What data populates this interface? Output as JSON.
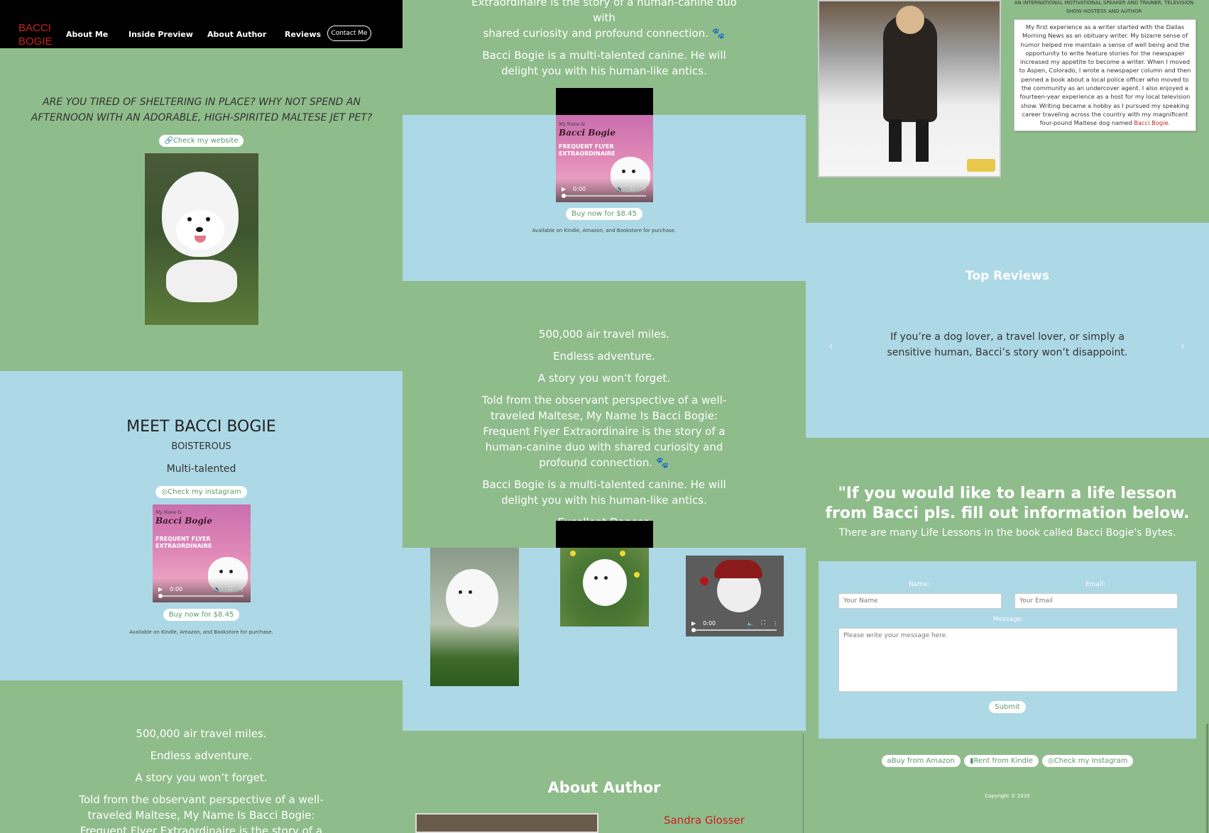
{
  "nav": {
    "brand_line1": "BACCI",
    "brand_line2": "BOGIE",
    "items": [
      "About Me",
      "Inside Preview",
      "About Author",
      "Reviews"
    ],
    "contact": "Contact Me"
  },
  "hero": {
    "tagline": "ARE YOU TIRED OF SHELTERING IN PLACE? WHY NOT SPEND AN AFTERNOON WITH AN ADORABLE, HIGH-SPIRITED MALTESE JET PET?",
    "website_btn": "Check my website"
  },
  "meet": {
    "title": "MEET BACCI BOGIE",
    "line1": "BOISTEROUS",
    "line2": "Multi-talented",
    "instagram_btn": "Check my instagram",
    "buy_btn": "Buy now for $8.45",
    "available": "Available on Kindle, Amazon, and Bookstore for purchase."
  },
  "book_cover": {
    "line1": "My Name Is",
    "line2": "Bacci Bogie",
    "line3": "FREQUENT FLYER",
    "line4": "EXTRAORDINAIRE",
    "time": "0:00"
  },
  "story": {
    "p1": "500,000 air travel miles.",
    "p2": "Endless adventure.",
    "p3": "A story you won’t forget.",
    "p4": "Told from the observant perspective of a well-traveled Maltese, My Name Is Bacci Bogie: Frequent Flyer Extraordinaire is the story of a human-canine duo with shared curiosity and profound connection.",
    "p5": "Bacci Bogie is a multi-talented canine. He will delight you with his human-like antics.",
    "p6": "Excellent Dancer.",
    "top_partial": "Extraordinaire is the story of a human-canine duo with",
    "top_partial2": "shared curiosity and profound connection.",
    "bottom_partial": "Extraordinaire is the story of a human-canine duo with"
  },
  "gallery": {
    "video_time": "0:00"
  },
  "about_author": {
    "title": "About Author",
    "name": "Sandra Glosser",
    "subtitle": "AN INTERNATIONAL MOTIVATIONAL SPEAKER AND TRAINER, TELEVISION SHOW HOSTESS AND AUTHOR",
    "bio": "My first experience as a writer started with the Dallas Morning News as an obituary writer. My bizarre sense of humor helped me maintain a sense of well being and the opportunity to write feature stories for the newspaper increased my appetite to become a writer. When I moved to Aspen, Colorado, I wrote a newspaper column and then penned a book about a local police officer who moved to the community as an undercover agent. I also enjoyed a fourteen-year experience as a host for my local television show. Writing became a hobby as I pursued my speaking career traveling across the country with my magnificent four-pound Maltese dog named",
    "bio_link": "Bacci Bogie."
  },
  "reviews": {
    "title": "Top Reviews",
    "quote": "If you’re a dog lover, a travel lover, or simply a sensitive human, Bacci’s story won’t disappoint."
  },
  "contact": {
    "headline": "\"If you would like to learn a life lesson from Bacci pls. fill out information below.",
    "sub": "There are many Life Lessons in the book called Bacci Bogie's Bytes.",
    "name_label": "Name:",
    "name_placeholder": "Your Name",
    "email_label": "Email:",
    "email_placeholder": "Your Email",
    "message_label": "Message:",
    "message_placeholder": "Please write your message here.",
    "submit": "Submit"
  },
  "footer": {
    "amazon": "Buy from Amazon",
    "kindle": "Rent from Kindle",
    "instagram": "Check my Instagram",
    "copyright": "Copyright © 2020"
  },
  "colors": {
    "green": "#8fbc8b",
    "blue": "#add8e6",
    "brand_red": "#cc2020",
    "nav_black": "#000000"
  }
}
